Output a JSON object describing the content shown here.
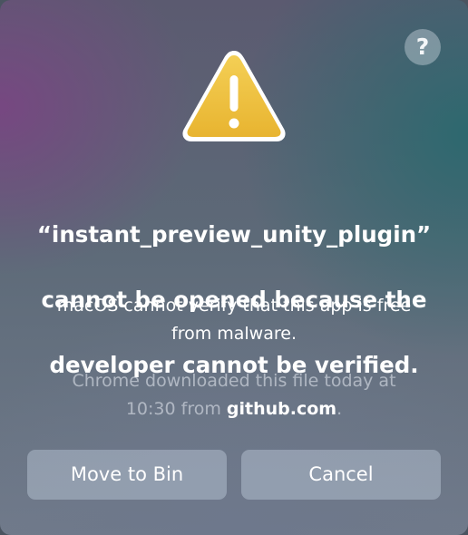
{
  "dialog": {
    "help_label": "?",
    "icon": "warning-triangle-icon",
    "title_line1": "“instant_preview_unity_plugin”",
    "title_line2": "cannot be opened because the",
    "title_line3": "developer cannot be verified.",
    "message_line1": "macOS cannot verify that this app is free",
    "message_line2": "from malware.",
    "info_line1": "Chrome downloaded this file today at",
    "info_time_prefix": "10:30 from ",
    "info_domain": "github.com",
    "info_suffix": ".",
    "buttons": {
      "move_to_bin": "Move to Bin",
      "cancel": "Cancel"
    },
    "colors": {
      "warning_fill": "#EEC140",
      "warning_border": "#FFFFFF",
      "button_bg": "rgba(190,205,220,0.45)"
    }
  }
}
